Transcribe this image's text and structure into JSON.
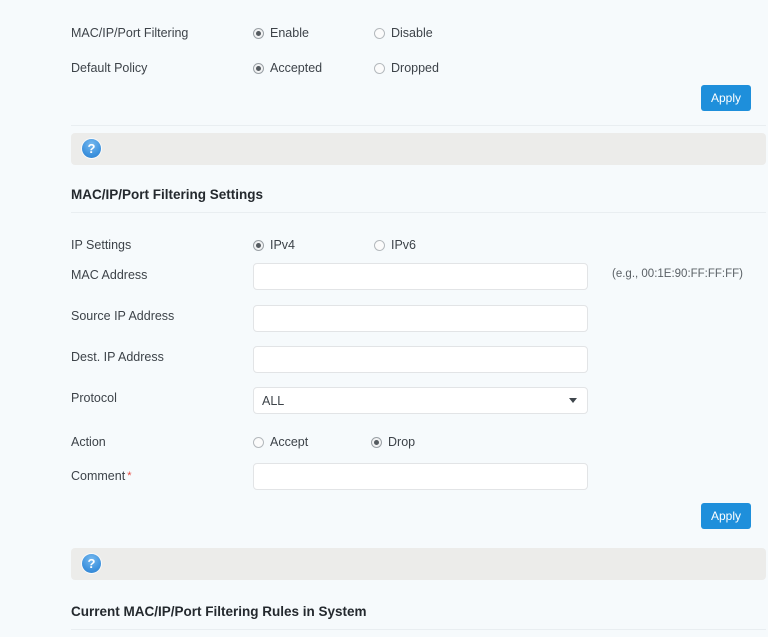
{
  "top_section": {
    "rows": [
      {
        "label": "MAC/IP/Port Filtering",
        "options": [
          {
            "text": "Enable",
            "selected": true
          },
          {
            "text": "Disable",
            "selected": false
          }
        ]
      },
      {
        "label": "Default Policy",
        "options": [
          {
            "text": "Accepted",
            "selected": true
          },
          {
            "text": "Dropped",
            "selected": false
          }
        ]
      }
    ],
    "apply_label": "Apply"
  },
  "help_bar_1": {
    "icon": "help-question-icon",
    "glyph": "?"
  },
  "settings_section": {
    "title": "MAC/IP/Port Filtering Settings",
    "ip_settings": {
      "label": "IP Settings",
      "options": [
        {
          "text": "IPv4",
          "selected": true
        },
        {
          "text": "IPv6",
          "selected": false
        }
      ]
    },
    "mac_address": {
      "label": "MAC Address",
      "value": "",
      "placeholder": "",
      "hint": "(e.g., 00:1E:90:FF:FF:FF)"
    },
    "source_ip": {
      "label": "Source IP Address",
      "value": "",
      "placeholder": ""
    },
    "dest_ip": {
      "label": "Dest. IP Address",
      "value": "",
      "placeholder": ""
    },
    "protocol": {
      "label": "Protocol",
      "selected": "ALL",
      "caret": "chevron-down-icon"
    },
    "action": {
      "label": "Action",
      "options": [
        {
          "text": "Accept",
          "selected": false
        },
        {
          "text": "Drop",
          "selected": true
        }
      ]
    },
    "comment": {
      "label": "Comment",
      "required_marker": "*",
      "value": "",
      "placeholder": ""
    },
    "apply_label": "Apply"
  },
  "help_bar_2": {
    "icon": "help-question-icon",
    "glyph": "?"
  },
  "rules_section": {
    "title": "Current MAC/IP/Port Filtering Rules in System"
  },
  "colors": {
    "page_bg": "#f6fafc",
    "accent_blue": "#1e8fdb",
    "help_bar_bg": "#ececea",
    "required_red": "#e8483f",
    "text": "#3d4349"
  }
}
